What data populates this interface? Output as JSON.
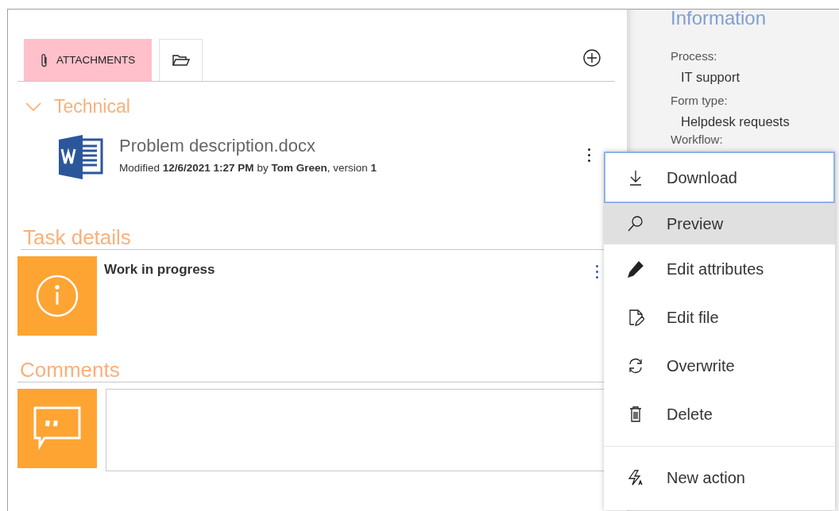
{
  "tabs": [
    {
      "kind": "attachments",
      "label": "ATTACHMENTS",
      "selected": true
    },
    {
      "kind": "folder",
      "selected": false
    }
  ],
  "attachments": {
    "group": {
      "title": "Technical",
      "expanded": true
    },
    "files": [
      {
        "name": "Problem description.docx",
        "meta": "Modified **12/6/2021 1:27 PM** by **Tom Green**, version **1**"
      }
    ]
  },
  "task_details": {
    "title": "Task details",
    "status": "Work in progress"
  },
  "comments": {
    "title": "Comments"
  },
  "information": {
    "title": "Information",
    "fields": [
      {
        "label": "Process:",
        "value": "IT support"
      },
      {
        "label": "Form type:",
        "value": "Helpdesk requests"
      },
      {
        "label": "Workflow:"
      }
    ]
  },
  "context_menu": {
    "items": [
      {
        "kind": "download",
        "label": "Download",
        "focused": true,
        "hovered": false
      },
      {
        "kind": "preview",
        "label": "Preview",
        "focused": false,
        "hovered": true
      },
      {
        "kind": "edit-attributes",
        "label": "Edit attributes",
        "focused": false,
        "hovered": false
      },
      {
        "kind": "edit-file",
        "label": "Edit file",
        "focused": false,
        "hovered": false
      },
      {
        "kind": "overwrite",
        "label": "Overwrite",
        "focused": false,
        "hovered": false
      },
      {
        "kind": "delete",
        "label": "Delete",
        "focused": false,
        "hovered": false
      },
      {
        "kind": "new-action",
        "label": "New action",
        "focused": false,
        "hovered": false,
        "separated": true
      }
    ]
  }
}
